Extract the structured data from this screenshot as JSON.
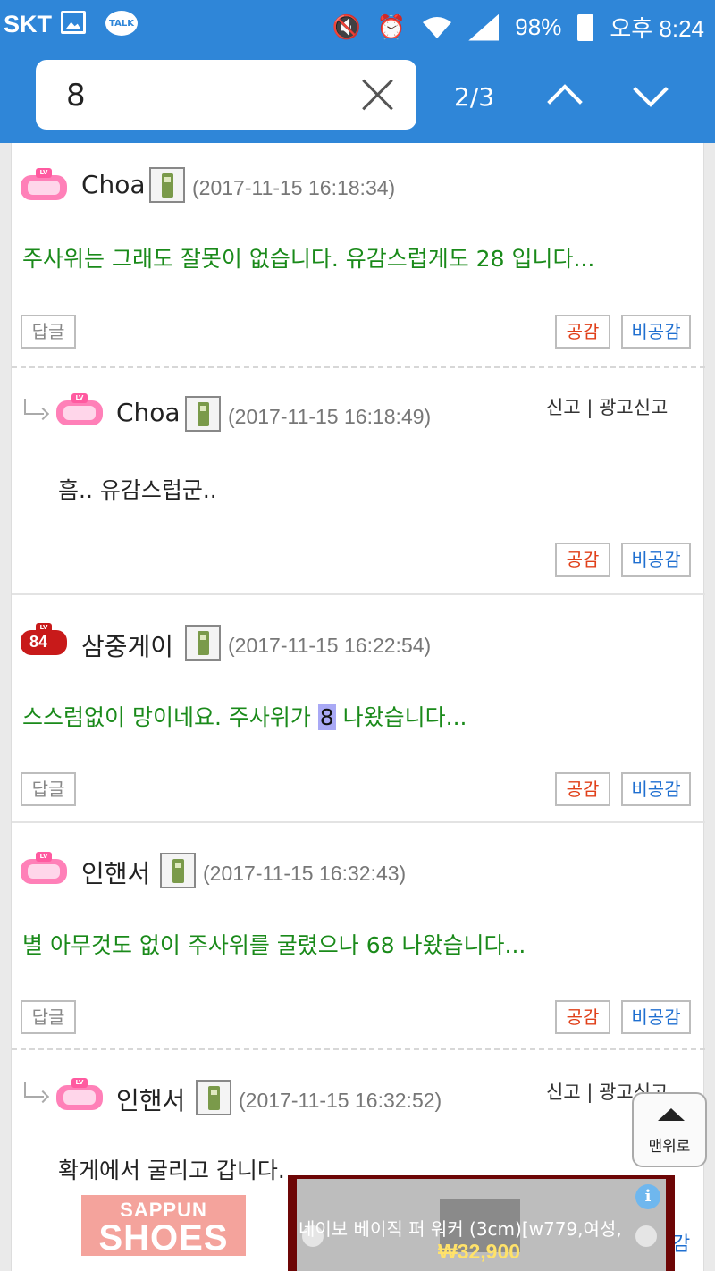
{
  "status_bar": {
    "carrier": "SKT",
    "talk_label": "TALK",
    "battery": "98%",
    "time": "오후 8:24"
  },
  "find_bar": {
    "query": "8",
    "match_count": "2/3"
  },
  "comments": [
    {
      "author": "Choa",
      "timestamp": "(2017-11-15 16:18:34)",
      "text": "주사위는 그래도 잘못이 없습니다. 유감스럽게도 28 입니다...",
      "reply_label": "답글",
      "like_label": "공감",
      "dislike_label": "비공감"
    },
    {
      "author": "Choa",
      "timestamp": "(2017-11-15 16:18:49)",
      "text": "흠.. 유감스럽군..",
      "report_label": "신고 | 광고신고",
      "like_label": "공감",
      "dislike_label": "비공감"
    },
    {
      "author": "삼중게이",
      "level": "84",
      "timestamp": "(2017-11-15 16:22:54)",
      "text_before": "스스럼없이 망이네요. 주사위가 ",
      "text_highlight": "8",
      "text_after": " 나왔습니다...",
      "reply_label": "답글",
      "like_label": "공감",
      "dislike_label": "비공감"
    },
    {
      "author": "인핸서",
      "timestamp": "(2017-11-15 16:32:43)",
      "text": "별 아무것도 없이 주사위를 굴렸으나 68 나왔습니다...",
      "reply_label": "답글",
      "like_label": "공감",
      "dislike_label": "비공감"
    },
    {
      "author": "인핸서",
      "timestamp": "(2017-11-15 16:32:52)",
      "text": "확게에서 굴리고 갑니다.",
      "report_label": "신고 | 광고신고"
    }
  ],
  "top_button_label": "맨위로",
  "ads": {
    "left_line1": "SAPPUN",
    "left_line2": "SHOES",
    "right_title": "네이보 베이직 퍼 워커 (3cm)[w779,여성,",
    "right_price": "₩32,900",
    "info_glyph": "i"
  },
  "peek_text": "감"
}
